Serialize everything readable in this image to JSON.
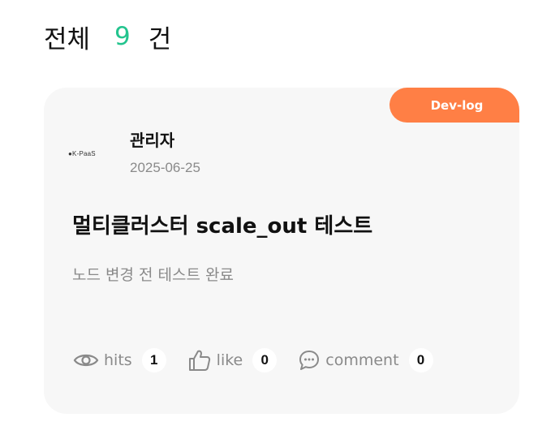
{
  "header": {
    "label": "전체",
    "count": "9",
    "unit": "건"
  },
  "card": {
    "category": "Dev-log",
    "author": {
      "name": "관리자",
      "date": "2025-06-25",
      "avatar_text": "K-PaaS"
    },
    "title": "멀티클러스터 scale_out 테스트",
    "summary": "노드 변경 전 테스트 완료",
    "stats": {
      "hits_label": "hits",
      "hits_count": "1",
      "like_label": "like",
      "like_count": "0",
      "comment_label": "comment",
      "comment_count": "0"
    }
  },
  "colors": {
    "count_accent": "#23c48e",
    "badge_bg": "#ff7f45",
    "card_bg": "#f7f7f7",
    "muted_text": "#8a8a8a"
  },
  "icons": {
    "hits": "eye-icon",
    "like": "thumbs-up-icon",
    "comment": "speech-bubble-icon"
  }
}
